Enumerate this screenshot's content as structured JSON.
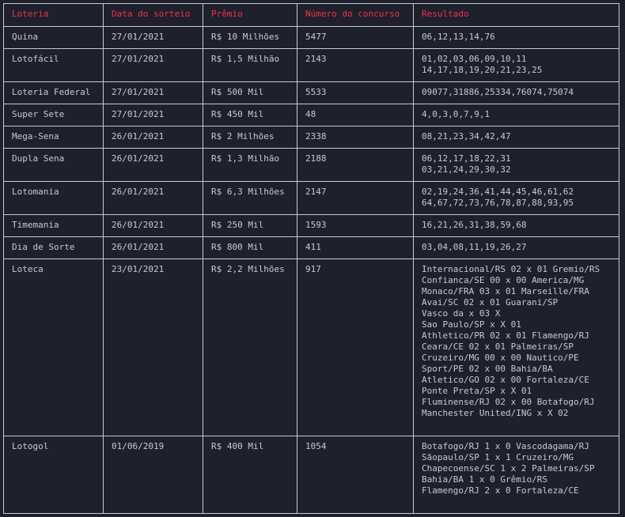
{
  "table": {
    "headers": [
      "Loteria",
      "Data do sorteio",
      "Prêmio",
      "Número do concurso",
      "Resultado"
    ],
    "rows": [
      {
        "loteria": "Quina",
        "data": "27/01/2021",
        "premio": "R$ 10 Milhões",
        "concurso": "5477",
        "resultado": "06,12,13,14,76"
      },
      {
        "loteria": "Lotofácil",
        "data": "27/01/2021",
        "premio": "R$ 1,5 Milhão",
        "concurso": "2143",
        "resultado": "01,02,03,06,09,10,11\n14,17,18,19,20,21,23,25"
      },
      {
        "loteria": "Loteria Federal",
        "data": "27/01/2021",
        "premio": "R$ 500 Mil",
        "concurso": "5533",
        "resultado": "09077,31886,25334,76074,75074"
      },
      {
        "loteria": "Super Sete",
        "data": "27/01/2021",
        "premio": "R$ 450 Mil",
        "concurso": "48",
        "resultado": "4,0,3,0,7,9,1"
      },
      {
        "loteria": "Mega-Sena",
        "data": "26/01/2021",
        "premio": "R$ 2 Milhões",
        "concurso": "2338",
        "resultado": "08,21,23,34,42,47"
      },
      {
        "loteria": "Dupla Sena",
        "data": "26/01/2021",
        "premio": "R$ 1,3 Milhão",
        "concurso": "2188",
        "resultado": "06,12,17,18,22,31\n03,21,24,29,30,32"
      },
      {
        "loteria": "Lotomania",
        "data": "26/01/2021",
        "premio": "R$ 6,3 Milhões",
        "concurso": "2147",
        "resultado": "02,19,24,36,41,44,45,46,61,62\n64,67,72,73,76,78,87,88,93,95"
      },
      {
        "loteria": "Timemania",
        "data": "26/01/2021",
        "premio": "R$ 250 Mil",
        "concurso": "1593",
        "resultado": "16,21,26,31,38,59,68"
      },
      {
        "loteria": "Dia de Sorte",
        "data": "26/01/2021",
        "premio": "R$ 800 Mil",
        "concurso": "411",
        "resultado": "03,04,08,11,19,26,27"
      },
      {
        "loteria": "Loteca",
        "data": "23/01/2021",
        "premio": "R$ 2,2 Milhões",
        "concurso": "917",
        "resultado": "Internacional/RS 02 x 01 Gremio/RS\nConfianca/SE 00 x 00 America/MG\nMonaco/FRA 03 x 01 Marseille/FRA\nAvai/SC 02 x 01 Guarani/SP\nVasco da x 03 X\nSao Paulo/SP x X 01\nAthletico/PR 02 x 01 Flamengo/RJ\nCeara/CE 02 x 01 Palmeiras/SP\nCruzeiro/MG 00 x 00 Nautico/PE\nSport/PE 02 x 00 Bahia/BA\nAtletico/GO 02 x 00 Fortaleza/CE\nPonte Preta/SP x X 01\nFluminense/RJ 02 x 00 Botafogo/RJ\nManchester United/ING x X 02"
      },
      {
        "loteria": "Lotogol",
        "data": "01/06/2019",
        "premio": "R$ 400 Mil",
        "concurso": "1054",
        "resultado": "Botafogo/RJ 1 x 0 Vascodagama/RJ\nSãopaulo/SP 1 x 1 Cruzeiro/MG\nChapecoense/SC 1 x 2 Palmeiras/SP\nBahia/BA 1 x 0 Grêmio/RS\nFlamengo/RJ 2 x 0 Fortaleza/CE"
      }
    ]
  },
  "colors": {
    "background": "#1e212c",
    "header_text": "#f0304a",
    "body_text": "#c8cad1",
    "border": "#c8cad1"
  }
}
